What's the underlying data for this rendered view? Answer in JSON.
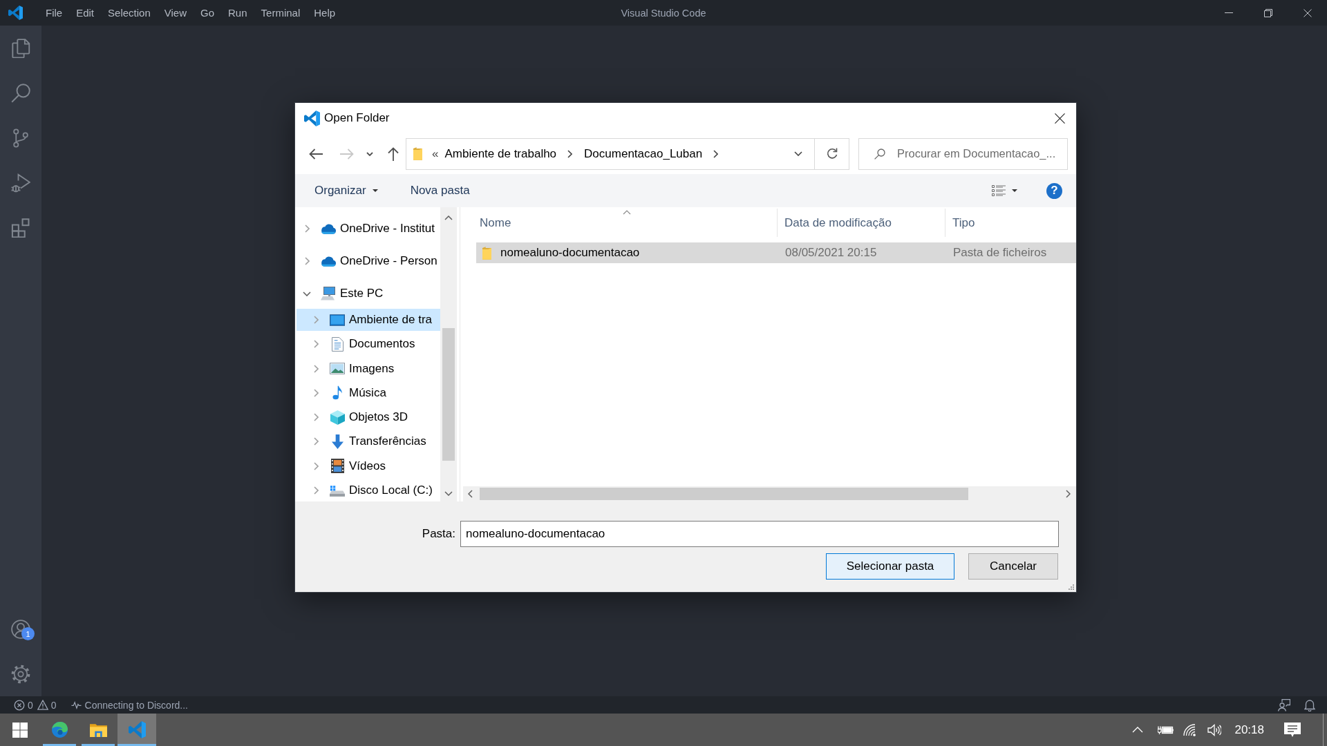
{
  "window": {
    "title": "Visual Studio Code"
  },
  "menu_bar": [
    "File",
    "Edit",
    "Selection",
    "View",
    "Go",
    "Run",
    "Terminal",
    "Help"
  ],
  "activity_bar": {
    "account_badge": "1"
  },
  "dialog": {
    "title": "Open Folder",
    "nav_buttons": [
      {
        "kind": "back",
        "disabled": false
      },
      {
        "kind": "forward",
        "disabled": true
      },
      {
        "kind": "recent",
        "disabled": false
      },
      {
        "kind": "up",
        "disabled": false
      }
    ],
    "address_bar": {
      "overflow_marker": "«",
      "breadcrumbs": [
        "Ambiente de trabalho",
        "Documentacao_Luban"
      ]
    },
    "search": {
      "placeholder": "Procurar em Documentacao_..."
    },
    "command_bar": {
      "organize": "Organizar",
      "new_folder": "Nova pasta",
      "help": "?"
    },
    "nav_pane": {
      "items": [
        {
          "label": "OneDrive - Institut",
          "kind": "cloud",
          "expanded": false,
          "selected": false
        },
        {
          "label": "OneDrive - Person",
          "kind": "cloud",
          "expanded": false,
          "selected": false
        },
        {
          "label": "Este PC",
          "kind": "computer",
          "expanded": true,
          "selected": false,
          "children": [
            {
              "label": "Ambiente de tra",
              "kind": "desktop",
              "expanded": false,
              "selected": true
            },
            {
              "label": "Documentos",
              "kind": "documents",
              "expanded": false,
              "selected": false
            },
            {
              "label": "Imagens",
              "kind": "pictures",
              "expanded": false,
              "selected": false
            },
            {
              "label": "Música",
              "kind": "music",
              "expanded": false,
              "selected": false
            },
            {
              "label": "Objetos 3D",
              "kind": "objects",
              "expanded": false,
              "selected": false
            },
            {
              "label": "Transferências",
              "kind": "downloads",
              "expanded": false,
              "selected": false
            },
            {
              "label": "Vídeos",
              "kind": "videos",
              "expanded": false,
              "selected": false
            },
            {
              "label": "Disco Local (C:)",
              "kind": "drive",
              "expanded": false,
              "selected": false
            }
          ]
        }
      ]
    },
    "table": {
      "columns": [
        {
          "label": "Nome",
          "sorted": true
        },
        {
          "label": "Data de modificação",
          "sorted": false
        },
        {
          "label": "Tipo",
          "sorted": false
        }
      ],
      "rows": [
        {
          "name": "nomealuno-documentacao",
          "date": "08/05/2021 20:15",
          "type": "Pasta de ficheiros",
          "selected": true
        }
      ]
    },
    "footer": {
      "label": "Pasta:",
      "value": "nomealuno-documentacao"
    },
    "buttons": [
      {
        "kind": "confirm",
        "label": "Selecionar pasta",
        "default": true
      },
      {
        "kind": "cancel",
        "label": "Cancelar",
        "default": false
      }
    ]
  },
  "status_bar": {
    "errors": "0",
    "warnings": "0",
    "message": "Connecting to Discord..."
  },
  "taskbar": {
    "apps": [
      {
        "kind": "browser",
        "running": true,
        "active": false
      },
      {
        "kind": "files",
        "running": true,
        "active": false
      },
      {
        "kind": "editor",
        "running": true,
        "active": true
      }
    ],
    "clock": "20:18"
  }
}
